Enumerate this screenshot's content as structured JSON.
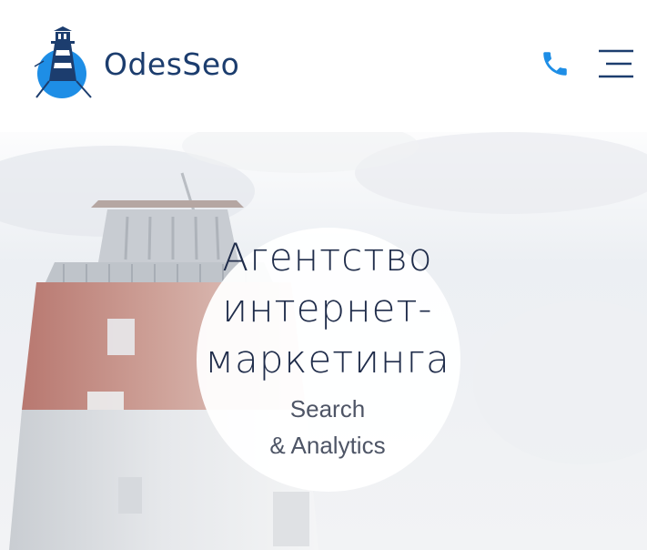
{
  "header": {
    "brand_name": "OdesSeo",
    "phone_icon": "phone-icon",
    "menu_icon": "hamburger-menu-icon",
    "accent_color": "#1e8ee6",
    "brand_text_color": "#1c3d6e"
  },
  "hero": {
    "title_lines": [
      "Агентство",
      "интернет-",
      "маркетинга"
    ],
    "subtitle_lines": [
      "Search",
      "& Analytics"
    ],
    "background": "lighthouse-photo",
    "title_color": "#1f2c4a"
  }
}
